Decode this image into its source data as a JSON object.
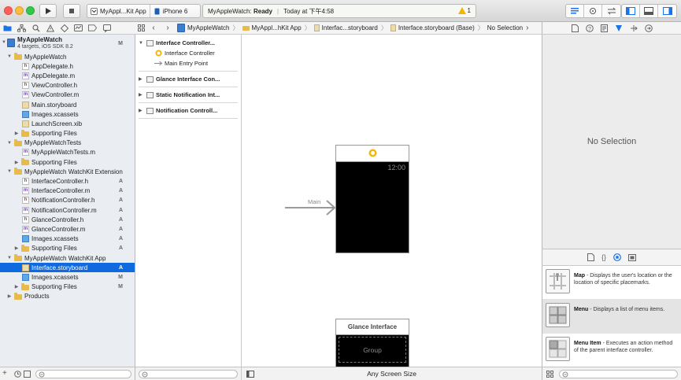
{
  "toolbar": {
    "scheme_name": "MyAppl...Kit App",
    "scheme_device": "iPhone 6",
    "activity_project": "MyAppleWatch:",
    "activity_status": "Ready",
    "activity_time": "Today at 下午4:58",
    "warning_count": "1"
  },
  "navigator": {
    "items": [
      {
        "label": "MyAppleWatch",
        "sub": "4 targets, iOS SDK 8.2",
        "badge": "M"
      },
      {
        "label": "MyAppleWatch"
      },
      {
        "label": "AppDelegate.h"
      },
      {
        "label": "AppDelegate.m"
      },
      {
        "label": "ViewController.h"
      },
      {
        "label": "ViewController.m"
      },
      {
        "label": "Main.storyboard"
      },
      {
        "label": "Images.xcassets"
      },
      {
        "label": "LaunchScreen.xib"
      },
      {
        "label": "Supporting Files"
      },
      {
        "label": "MyAppleWatchTests"
      },
      {
        "label": "MyAppleWatchTests.m"
      },
      {
        "label": "Supporting Files"
      },
      {
        "label": "MyAppleWatch WatchKit Extension"
      },
      {
        "label": "InterfaceController.h",
        "badge": "A"
      },
      {
        "label": "InterfaceController.m",
        "badge": "A"
      },
      {
        "label": "NotificationController.h",
        "badge": "A"
      },
      {
        "label": "NotificationController.m",
        "badge": "A"
      },
      {
        "label": "GlanceController.h",
        "badge": "A"
      },
      {
        "label": "GlanceController.m",
        "badge": "A"
      },
      {
        "label": "Images.xcassets",
        "badge": "A"
      },
      {
        "label": "Supporting Files",
        "badge": "A"
      },
      {
        "label": "MyAppleWatch WatchKit App"
      },
      {
        "label": "Interface.storyboard",
        "badge": "A"
      },
      {
        "label": "Images.xcassets",
        "badge": "M"
      },
      {
        "label": "Supporting Files",
        "badge": "M"
      },
      {
        "label": "Products"
      }
    ]
  },
  "jumpbar": {
    "items": [
      "MyAppleWatch",
      "MyAppl...hKit App",
      "Interfac...storyboard",
      "Interface.storyboard (Base)",
      "No Selection"
    ]
  },
  "outline": {
    "scene1_title": "Interface Controller...",
    "scene1_child1": "Interface Controller",
    "scene1_child2": "Main Entry Point",
    "scene2_title": "Glance Interface Con...",
    "scene3_title": "Static Notification Int...",
    "scene4_title": "Notification Controll..."
  },
  "canvas": {
    "watch_time": "12:00",
    "entry_label": "Main",
    "glance_title": "Glance Interface",
    "group_label": "Group",
    "footer_label": "Any Screen Size"
  },
  "inspector": {
    "empty_label": "No Selection"
  },
  "library": {
    "items": [
      {
        "name": "Map",
        "desc": " - Displays the user's location or the location of specific placemarks."
      },
      {
        "name": "Menu",
        "desc": " - Displays a list of menu items."
      },
      {
        "name": "Menu Item",
        "desc": " - Executes an action method of the parent interface controller."
      }
    ]
  },
  "colors": {
    "selection": "#0f6ae0",
    "accent": "#1a73e8",
    "warning": "#f2b600",
    "interface_controller_icon": "#f5b700"
  }
}
